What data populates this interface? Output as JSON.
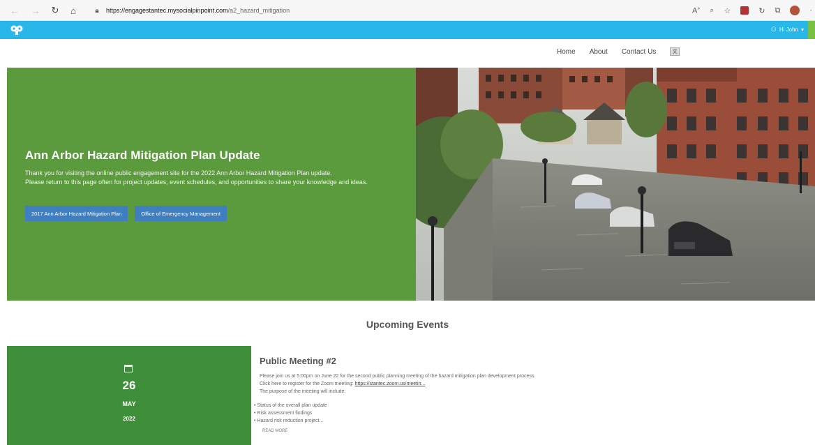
{
  "browser": {
    "url_host": "https://engagestantec.mysocialpinpoint.com",
    "url_path": "/a2_hazard_mitigation",
    "read_aloud": "A",
    "read_aloud_sup": "»"
  },
  "site": {
    "user_label": "Hi John",
    "user_caret": "▾"
  },
  "nav": {
    "items": [
      "Home",
      "About",
      "Contact Us"
    ]
  },
  "hero": {
    "title": "Ann Arbor Hazard Mitigation Plan Update",
    "text_line1": "Thank you for visiting the online public engagement site for the 2022 Ann Arbor Hazard Mitigation Plan update.",
    "text_line2": "Please return to this page often for project updates, event schedules, and opportunities to share your knowledge and ideas.",
    "buttons": [
      "2017 Ann Arbor Hazard Mitigation Plan",
      "Office of Emergency Management"
    ]
  },
  "events": {
    "section_title": "Upcoming Events",
    "items": [
      {
        "day": "26",
        "month": "MAY",
        "year": "2022",
        "title": "Public Meeting #2",
        "line1": "Please join us at 5:00pm on June 22 for the second public planning meeting of the hazard mitigation plan development process.",
        "line2_prefix": "Click here to register for the Zoom meeting: ",
        "line2_link": "https://stantec.zoom.us/meetin...",
        "line3": "The purpose of the meeting will include:",
        "bullets": [
          "Status of the overall plan update",
          "Risk assessment findings",
          "Hazard risk reduction project..."
        ],
        "read_more": "READ MORE"
      }
    ]
  },
  "colors": {
    "site_bar": "#29b6e8",
    "hero_green": "#5b9a3d",
    "event_green": "#3f8f3a",
    "button_blue": "#3f7fbf"
  }
}
